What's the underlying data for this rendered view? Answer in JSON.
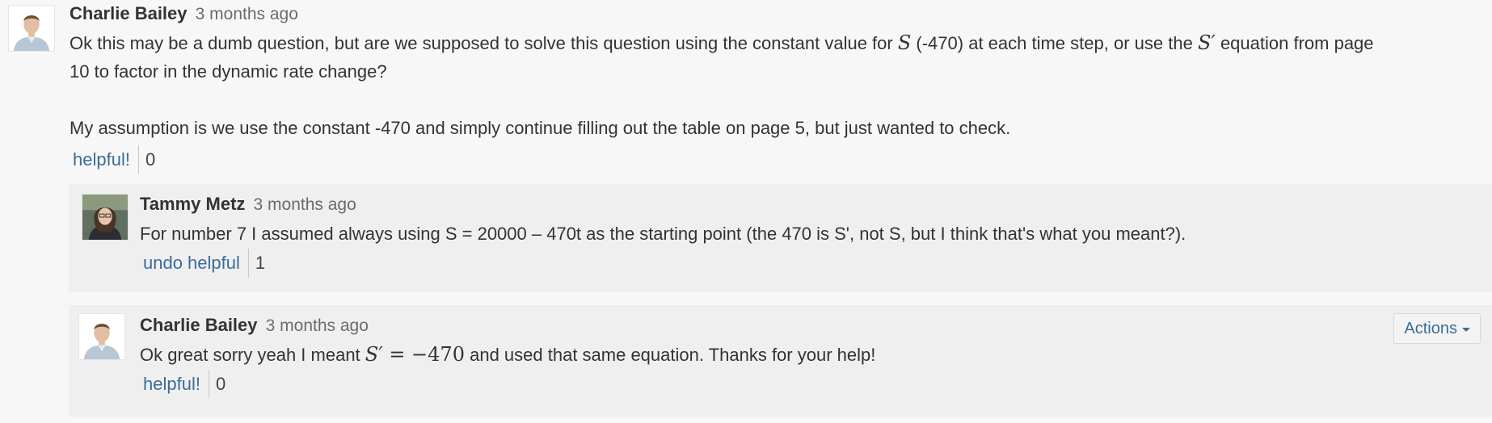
{
  "comment": {
    "author": "Charlie Bailey",
    "time": "3 months ago",
    "line1": {
      "before_s": "Ok this may be a dumb question, but are we supposed to solve this question using the constant value for",
      "s_symbol": "S",
      "middle": " (-470) at each time step, or use the",
      "s_prime_symbol": "S′",
      "after": " equation from page"
    },
    "line2": "10 to factor in the dynamic rate change?",
    "line3": "My assumption is we use the constant -470 and simply continue filling out the table on page 5, but just wanted to check.",
    "vote": {
      "label": "helpful!",
      "count": "0"
    }
  },
  "replies": [
    {
      "author": "Tammy Metz",
      "time": "3 months ago",
      "text": "For number 7 I assumed always using S = 20000 – 470t as the starting point (the 470 is S', not S, but I think that's what you meant?).",
      "vote": {
        "label": "undo helpful",
        "count": "1"
      }
    },
    {
      "author": "Charlie Bailey",
      "time": "3 months ago",
      "text_before": "Ok great sorry yeah I meant",
      "math_lhs": "S′",
      "math_eq": " = −470",
      "text_after": " and used that same equation. Thanks for your help!",
      "vote": {
        "label": "helpful!",
        "count": "0"
      },
      "actions_label": "Actions"
    }
  ]
}
